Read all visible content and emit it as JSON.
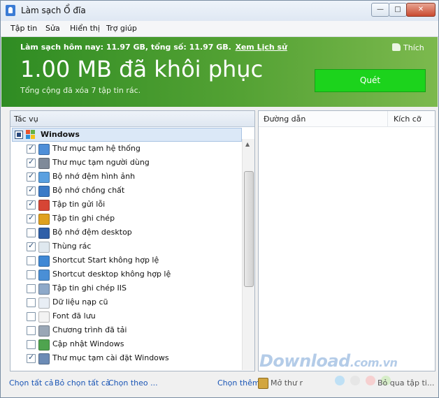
{
  "window": {
    "title": "Làm sạch Ổ đĩa",
    "controls": {
      "minimize": "—",
      "maximize": "□",
      "close": "✕"
    }
  },
  "menu": [
    "Tập tin",
    "Sửa",
    "Hiển thị",
    "Trợ giúp"
  ],
  "banner": {
    "today_text": "Làm sạch hôm nay: 11.97 GB, tổng số: 11.97 GB.",
    "history_link": "Xem Lịch sử",
    "big_text": "1.00 MB đã khôi phục",
    "total_text": "Tổng cộng đã xóa 7 tập tin rác.",
    "like": "Thích",
    "scan_button": "Quét"
  },
  "tasks": {
    "header": "Tác vụ",
    "group": "Windows",
    "items": [
      {
        "label": "Thư mục tạm hệ thống",
        "checked": true,
        "icon": "windows-folder-icon",
        "color": "#4f8fd8"
      },
      {
        "label": "Thư mục tạm người dùng",
        "checked": true,
        "icon": "user-folder-icon",
        "color": "#7f8a99"
      },
      {
        "label": "Bộ nhớ đệm hình ảnh",
        "checked": true,
        "icon": "image-cache-icon",
        "color": "#5aa0e0"
      },
      {
        "label": "Bộ nhớ chồng chất",
        "checked": true,
        "icon": "memory-stack-icon",
        "color": "#3c7bc7"
      },
      {
        "label": "Tập tin gửi lỗi",
        "checked": true,
        "icon": "error-report-icon",
        "color": "#d64535"
      },
      {
        "label": "Tập tin ghi chép",
        "checked": true,
        "icon": "log-file-icon",
        "color": "#e0a11e"
      },
      {
        "label": "Bộ nhớ đệm desktop",
        "checked": false,
        "icon": "desktop-cache-icon",
        "color": "#2f5fa8"
      },
      {
        "label": "Thùng rác",
        "checked": true,
        "icon": "recycle-bin-icon",
        "color": "#dfe8ef"
      },
      {
        "label": "Shortcut Start không hợp lệ",
        "checked": false,
        "icon": "start-shortcut-icon",
        "color": "#3f88d5"
      },
      {
        "label": "Shortcut desktop không hợp lệ",
        "checked": false,
        "icon": "desktop-shortcut-icon",
        "color": "#4a8fd6"
      },
      {
        "label": "Tập tin ghi chép IIS",
        "checked": false,
        "icon": "iis-log-icon",
        "color": "#8ea9c9"
      },
      {
        "label": "Dữ liệu nạp cũ",
        "checked": false,
        "icon": "clock-icon",
        "color": "#e8eef5"
      },
      {
        "label": "Font đã lưu",
        "checked": false,
        "icon": "font-icon",
        "color": "#f3f3f3"
      },
      {
        "label": "Chương trình đã tải",
        "checked": false,
        "icon": "downloaded-program-icon",
        "color": "#9aa7b6"
      },
      {
        "label": "Cập nhật Windows",
        "checked": false,
        "icon": "windows-update-icon",
        "color": "#4fa44f"
      },
      {
        "label": "Thư mục tạm cài đặt Windows",
        "checked": true,
        "icon": "setup-temp-icon",
        "color": "#6c8bb5"
      }
    ]
  },
  "details": {
    "col_path": "Đường dẫn",
    "col_size": "Kích cỡ"
  },
  "footer": {
    "select_all": "Chọn tất cả",
    "deselect_all": "Bỏ chọn tất cả",
    "select_by": "Chọn theo ...",
    "select_more": "Chọn thêm",
    "open_folder": "Mở thư r",
    "skip_files": "Bỏ qua tập ti..."
  },
  "watermark": {
    "main": "Download",
    "suffix": ".com.vn"
  },
  "colors": {
    "banner": "#54a234",
    "scan": "#1cd31c",
    "link": "#1a55b5"
  }
}
